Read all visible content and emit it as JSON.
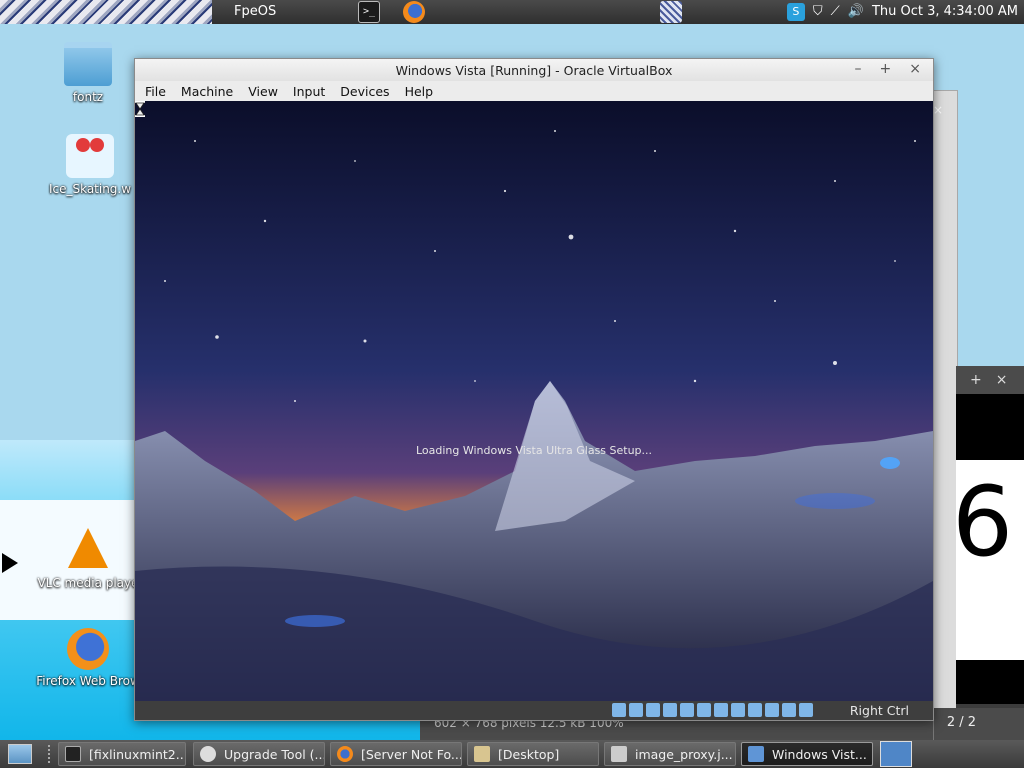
{
  "top_panel": {
    "distro_label": "FpeOS",
    "terminal_glyph": ">_",
    "clock": "Thu Oct  3,  4:34:00 AM",
    "tray_icons": [
      "skype-icon",
      "shield-icon",
      "network-icon",
      "volume-icon"
    ]
  },
  "desktop": {
    "icons": [
      {
        "label": "fontz",
        "icon": "folder-icon"
      },
      {
        "label": "Ice_Skating.w",
        "icon": "image-file-icon"
      },
      {
        "label": "VLC media playe",
        "icon": "vlc-icon"
      },
      {
        "label": "Firefox Web Brow",
        "icon": "firefox-icon"
      }
    ]
  },
  "vbox": {
    "title": "Windows Vista [Running] - Oracle VirtualBox",
    "window_buttons": {
      "minimize": "–",
      "maximize": "+",
      "close": "×"
    },
    "menu": [
      "File",
      "Machine",
      "View",
      "Input",
      "Devices",
      "Help"
    ],
    "loading_text": "Loading Windows Vista Ultra Glass Setup...",
    "host_key": "Right Ctrl"
  },
  "viewer": {
    "window_buttons": {
      "maximize": "+",
      "close": "×"
    },
    "big_digit": "6",
    "info": "602 × 768 pixels  12.5 kB  100%",
    "page_indicator": "2 / 2"
  },
  "taskbar": {
    "tasks": [
      {
        "label": "[fixlinuxmint2...",
        "icon": "terminal-icon",
        "active": false
      },
      {
        "label": "Upgrade Tool (...",
        "icon": "shield-icon",
        "active": false
      },
      {
        "label": "[Server Not Fo...",
        "icon": "firefox-icon",
        "active": false
      },
      {
        "label": "[Desktop]",
        "icon": "folder-icon",
        "active": false
      },
      {
        "label": "image_proxy.j...",
        "icon": "image-icon",
        "active": false
      },
      {
        "label": "Windows Vist...",
        "icon": "virtualbox-icon",
        "active": true
      }
    ]
  },
  "colors": {
    "desktop_bg": "#a9d8ee",
    "panel_bg": "#3a3a3a",
    "vbox_chrome": "#ececec",
    "vm_sky": "#161b45",
    "sunset_glow": "#e8863a"
  }
}
